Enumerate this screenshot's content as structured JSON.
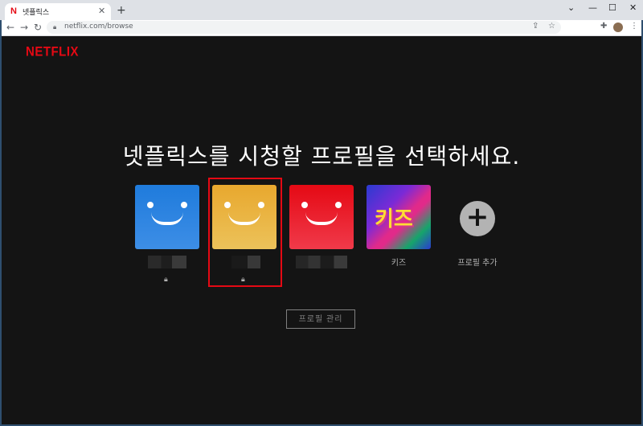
{
  "browser": {
    "tab_title": "넷플릭스",
    "tab_favicon": "N",
    "tab_close": "✕",
    "new_tab": "+",
    "url": "netflix.com/browse",
    "window_controls": {
      "dropdown": "⌄",
      "minimize": "—",
      "maximize": "☐",
      "close": "✕"
    }
  },
  "page": {
    "logo": "NETFLIX",
    "headline": "넷플릭스를 시청할 프로필을 선택하세요.",
    "profiles": [
      {
        "name": "",
        "color": "#1f7bdc",
        "icon": "smiley-face-icon",
        "locked": true
      },
      {
        "name": "",
        "color": "#e8b13a",
        "icon": "smiley-face-icon",
        "locked": true,
        "highlighted": true
      },
      {
        "name": "",
        "color": "#e50914",
        "icon": "smiley-face-icon",
        "locked": false
      },
      {
        "name": "키즈",
        "badge": "키즈",
        "icon": "kids-icon"
      },
      {
        "name": "프로필 추가",
        "icon": "add-circle-icon"
      }
    ],
    "manage_button": "프로필 관리"
  },
  "colors": {
    "brand_red": "#e50914",
    "background": "#141414",
    "highlight_border": "#e50914"
  }
}
